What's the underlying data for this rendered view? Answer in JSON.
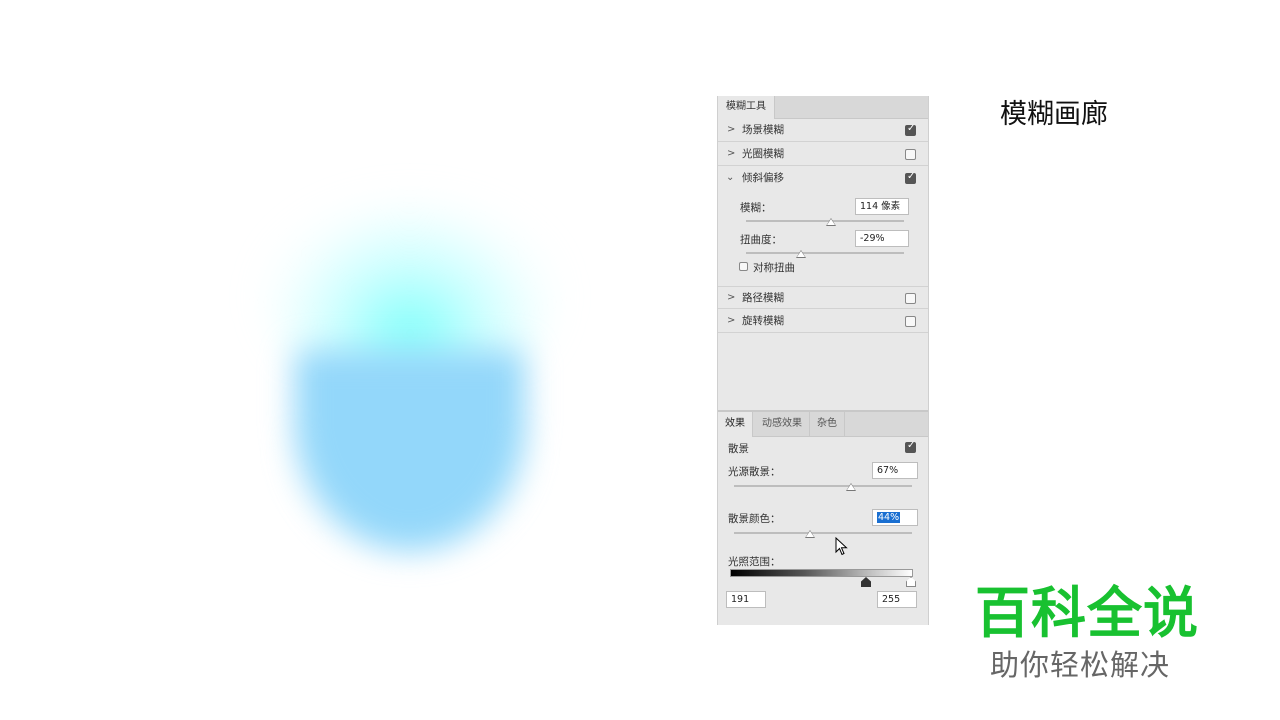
{
  "panel": {
    "tab_label": "模糊工具",
    "blur_items": [
      {
        "label": "场景模糊",
        "checked": true
      },
      {
        "label": "光圈模糊",
        "checked": false
      },
      {
        "label": "倾斜偏移",
        "checked": true
      },
      {
        "label": "路径模糊",
        "checked": false
      },
      {
        "label": "旋转模糊",
        "checked": false
      }
    ],
    "tilt_shift": {
      "blur_label": "模糊：",
      "blur_value": "114 像素",
      "distortion_label": "扭曲度：",
      "distortion_value": "-29%",
      "symmetric_label": "对称扭曲",
      "symmetric_checked": false
    }
  },
  "effects": {
    "tabs": [
      "效果",
      "动感效果",
      "杂色"
    ],
    "active_tab": "效果",
    "bokeh_label": "散景",
    "bokeh_checked": true,
    "light_bokeh_label": "光源散景：",
    "light_bokeh_value": "67%",
    "bokeh_color_label": "散景颜色：",
    "bokeh_color_value": "44%",
    "light_range_label": "光照范围：",
    "light_range_low": "191",
    "light_range_high": "255"
  },
  "gallery_title": "模糊画廊",
  "watermark": {
    "brand": "百科全说",
    "slogan": "助你轻松解决"
  },
  "colors": {
    "brand_green": "#18c130",
    "highlight_blue": "#1a6fd1",
    "bowl_blue": "#93d7fa",
    "glow_cyan": "#78fffa"
  }
}
